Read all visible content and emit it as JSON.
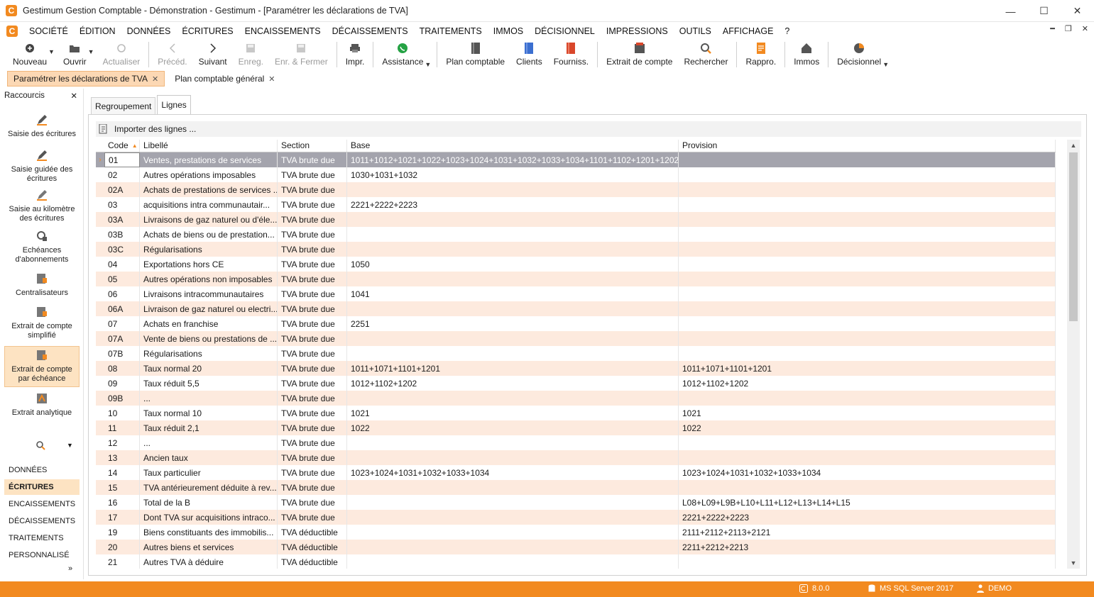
{
  "window": {
    "title": "Gestimum Gestion Comptable - Démonstration - Gestimum - [Paramétrer les déclarations de TVA]",
    "logo_letter": "C",
    "minimize": "—",
    "maximize": "☐",
    "close": "✕"
  },
  "menu": {
    "items": [
      "SOCIÉTÉ",
      "ÉDITION",
      "DONNÉES",
      "ÉCRITURES",
      "ENCAISSEMENTS",
      "DÉCAISSEMENTS",
      "TRAITEMENTS",
      "IMMOS",
      "DÉCISIONNEL",
      "IMPRESSIONS",
      "OUTILS",
      "AFFICHAGE",
      "?"
    ],
    "mdi": [
      "━",
      "❐",
      "✕"
    ]
  },
  "toolbar": {
    "buttons": [
      {
        "label": "Nouveau",
        "icon": "plus-circle-icon",
        "enabled": true,
        "dropdown": true
      },
      {
        "label": "Ouvrir",
        "icon": "folder-open-icon",
        "enabled": true,
        "dropdown": true
      },
      {
        "label": "Actualiser",
        "icon": "refresh-icon",
        "enabled": false
      },
      {
        "label": "Précéd.",
        "icon": "chevron-left-icon",
        "enabled": false
      },
      {
        "label": "Suivant",
        "icon": "chevron-right-icon",
        "enabled": true
      },
      {
        "label": "Enreg.",
        "icon": "save-icon",
        "enabled": false
      },
      {
        "label": "Enr. & Fermer",
        "icon": "save-close-icon",
        "enabled": false
      },
      {
        "label": "Impr.",
        "icon": "print-icon",
        "enabled": true
      },
      {
        "label": "Assistance",
        "icon": "whatsapp-icon",
        "enabled": true,
        "dropdown": true
      },
      {
        "label": "Plan comptable",
        "icon": "ledger-icon",
        "enabled": true
      },
      {
        "label": "Clients",
        "icon": "clients-icon",
        "enabled": true
      },
      {
        "label": "Fourniss.",
        "icon": "suppliers-icon",
        "enabled": true
      },
      {
        "label": "Extrait de compte",
        "icon": "account-statement-icon",
        "enabled": true
      },
      {
        "label": "Rechercher",
        "icon": "search-icon",
        "enabled": true
      },
      {
        "label": "Rappro.",
        "icon": "reconcile-icon",
        "enabled": true
      },
      {
        "label": "Immos",
        "icon": "house-icon",
        "enabled": true
      },
      {
        "label": "Décisionnel",
        "icon": "pie-chart-icon",
        "enabled": true,
        "dropdown": true
      }
    ]
  },
  "doc_tabs": [
    {
      "label": "Paramétrer les déclarations de TVA",
      "active": true,
      "close": "✕"
    },
    {
      "label": "Plan comptable général",
      "active": false,
      "close": "✕"
    }
  ],
  "sidebar": {
    "title": "Raccourcis",
    "close": "✕",
    "items": [
      {
        "label": "Saisie des écritures",
        "icon": "pen-icon"
      },
      {
        "label": "Saisie guidée des écritures",
        "icon": "guided-entry-icon"
      },
      {
        "label": "Saisie au kilomètre des écritures",
        "icon": "km-entry-icon"
      },
      {
        "label": "Echéances d'abonnements",
        "icon": "recurring-icon"
      },
      {
        "label": "Centralisateurs",
        "icon": "centralizer-icon"
      },
      {
        "label": "Extrait de compte simplifié",
        "icon": "statement-simple-icon"
      },
      {
        "label": "Extrait de compte par échéance",
        "icon": "statement-due-icon",
        "active": true
      },
      {
        "label": "Extrait analytique",
        "icon": "analytic-icon"
      }
    ],
    "more_arrow": "▼",
    "nav": [
      "DONNÉES",
      "ÉCRITURES",
      "ENCAISSEMENTS",
      "DÉCAISSEMENTS",
      "TRAITEMENTS",
      "PERSONNALISÉ"
    ],
    "nav_active": "ÉCRITURES",
    "expand": "»"
  },
  "subtabs": [
    "Regroupement",
    "Lignes"
  ],
  "subtab_active": "Lignes",
  "import_label": "Importer des lignes ...",
  "grid": {
    "columns": {
      "code": "Code",
      "libelle": "Libellé",
      "section": "Section",
      "base": "Base",
      "provision": "Provision"
    },
    "sort_indicator": "▲",
    "row_indicator": "›",
    "rows": [
      {
        "code": "01",
        "libelle": "Ventes, prestations de services",
        "section": "TVA brute due",
        "base": "1011+1012+1021+1022+1023+1024+1031+1032+1033+1034+1101+1102+1201+1202",
        "provision": ""
      },
      {
        "code": "02",
        "libelle": "Autres opérations imposables",
        "section": "TVA brute due",
        "base": "1030+1031+1032",
        "provision": ""
      },
      {
        "code": "02A",
        "libelle": "Achats de prestations de services ...",
        "section": "TVA brute due",
        "base": "",
        "provision": ""
      },
      {
        "code": "03",
        "libelle": "acquisitions intra communautair...",
        "section": "TVA brute due",
        "base": "2221+2222+2223",
        "provision": ""
      },
      {
        "code": "03A",
        "libelle": "Livraisons de gaz naturel ou d'éle...",
        "section": "TVA brute due",
        "base": "",
        "provision": ""
      },
      {
        "code": "03B",
        "libelle": "Achats de biens ou de prestation...",
        "section": "TVA brute due",
        "base": "",
        "provision": ""
      },
      {
        "code": "03C",
        "libelle": "Régularisations",
        "section": "TVA brute due",
        "base": "",
        "provision": ""
      },
      {
        "code": "04",
        "libelle": "Exportations hors CE",
        "section": "TVA brute due",
        "base": "1050",
        "provision": ""
      },
      {
        "code": "05",
        "libelle": "Autres opérations non imposables",
        "section": "TVA brute due",
        "base": "",
        "provision": ""
      },
      {
        "code": "06",
        "libelle": "Livraisons intracommunautaires",
        "section": "TVA brute due",
        "base": "1041",
        "provision": ""
      },
      {
        "code": "06A",
        "libelle": "Livraison de gaz naturel ou electri...",
        "section": "TVA brute due",
        "base": "",
        "provision": ""
      },
      {
        "code": "07",
        "libelle": "Achats en franchise",
        "section": "TVA brute due",
        "base": "2251",
        "provision": ""
      },
      {
        "code": "07A",
        "libelle": "Vente de biens ou prestations de ...",
        "section": "TVA brute due",
        "base": "",
        "provision": ""
      },
      {
        "code": "07B",
        "libelle": "Régularisations",
        "section": "TVA brute due",
        "base": "",
        "provision": ""
      },
      {
        "code": "08",
        "libelle": "Taux normal 20",
        "section": "TVA brute due",
        "base": "1011+1071+1101+1201",
        "provision": "1011+1071+1101+1201"
      },
      {
        "code": "09",
        "libelle": "Taux réduit 5,5",
        "section": "TVA brute due",
        "base": "1012+1102+1202",
        "provision": "1012+1102+1202"
      },
      {
        "code": "09B",
        "libelle": "...",
        "section": "TVA brute due",
        "base": "",
        "provision": ""
      },
      {
        "code": "10",
        "libelle": "Taux normal 10",
        "section": "TVA brute due",
        "base": "1021",
        "provision": "1021"
      },
      {
        "code": "11",
        "libelle": "Taux réduit 2,1",
        "section": "TVA brute due",
        "base": "1022",
        "provision": "1022"
      },
      {
        "code": "12",
        "libelle": "...",
        "section": "TVA brute due",
        "base": "",
        "provision": ""
      },
      {
        "code": "13",
        "libelle": "Ancien taux",
        "section": "TVA brute due",
        "base": "",
        "provision": ""
      },
      {
        "code": "14",
        "libelle": "Taux particulier",
        "section": "TVA brute due",
        "base": "1023+1024+1031+1032+1033+1034",
        "provision": "1023+1024+1031+1032+1033+1034"
      },
      {
        "code": "15",
        "libelle": "TVA antérieurement déduite à rev...",
        "section": "TVA brute due",
        "base": "",
        "provision": ""
      },
      {
        "code": "16",
        "libelle": "Total de la B",
        "section": "TVA brute due",
        "base": "",
        "provision": "L08+L09+L9B+L10+L11+L12+L13+L14+L15"
      },
      {
        "code": "17",
        "libelle": "Dont TVA sur acquisitions intraco...",
        "section": "TVA brute due",
        "base": "",
        "provision": "2221+2222+2223"
      },
      {
        "code": "19",
        "libelle": "Biens constituants des immobilis...",
        "section": "TVA déductible",
        "base": "",
        "provision": "2111+2112+2113+2121"
      },
      {
        "code": "20",
        "libelle": "Autres biens et services",
        "section": "TVA déductible",
        "base": "",
        "provision": "2211+2212+2213"
      },
      {
        "code": "21",
        "libelle": "Autres TVA à déduire",
        "section": "TVA déductible",
        "base": "",
        "provision": ""
      }
    ]
  },
  "statusbar": {
    "version": "8.0.0",
    "database": "MS SQL Server 2017",
    "user": "DEMO"
  },
  "colors": {
    "accent": "#f28a20",
    "row_alt": "#fdeade",
    "selected_row": "#a4a4ad",
    "active_tab": "#fcd8b4"
  }
}
